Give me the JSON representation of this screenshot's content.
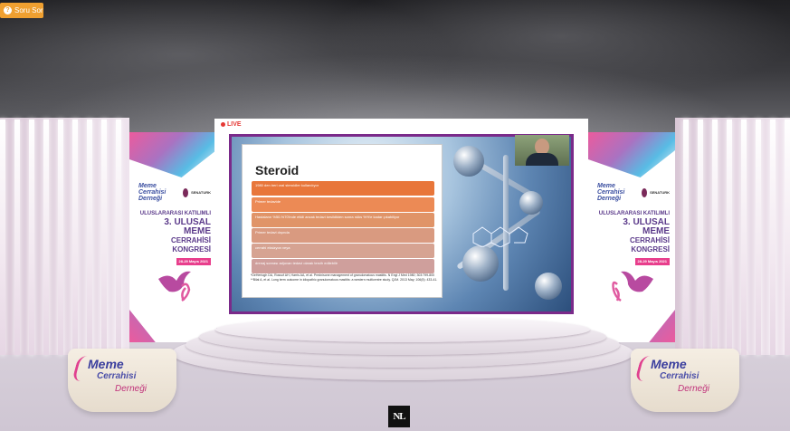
{
  "toolbar": {
    "ask_label": "Soru Sor",
    "ask_icon": "question-icon"
  },
  "stream": {
    "live_label": "LIVE"
  },
  "slide": {
    "title": "Steroid",
    "bars": [
      {
        "text": "1980 den beri oral steroidler kullanılıyor",
        "color": "#e8763a"
      },
      {
        "text": "Primer tedavide",
        "color": "#ec8a55"
      },
      {
        "text": "Hastaların %50-%70'inde etkili ancak tedavi kesildikten sonra nüks %%'e kadar çıkabiliyor",
        "color": "#e09468"
      },
      {
        "text": "Primer tedavi dışında",
        "color": "#d99a80"
      },
      {
        "text": "cerrahi eksizyon veya",
        "color": "#d6a392"
      },
      {
        "text": "drenaj sonrası adjuvan tedavi olarak tercih edilebilir",
        "color": "#cf9f9c"
      }
    ],
    "references": [
      "*DeHertogh DA, Rossof AH, Harris AA, et al. Prednisone management of granulomatous mastitis. N Engl J Med 1980; 303:799-800",
      "**Bilal A, et al. Long term outcome in idiopathic granulomatous mastitis: a western multicentre study. QJM. 2013 May; 106(5): 433-41."
    ]
  },
  "banner": {
    "org_name": "Meme Cerrahisi Derneği",
    "partner": "SENATURK",
    "line1": "ULUSLARARASI KATILIMLI",
    "line2": "3. ULUSAL MEME",
    "line3": "CERRAHİSİ KONGRESİ",
    "date": "28-29 Mayıs 2021"
  },
  "podium": {
    "brand_line1": "Meme",
    "brand_line2": "Cerrahisi",
    "brand_line3": "Derneği"
  },
  "footer": {
    "logo_text": "NL"
  }
}
